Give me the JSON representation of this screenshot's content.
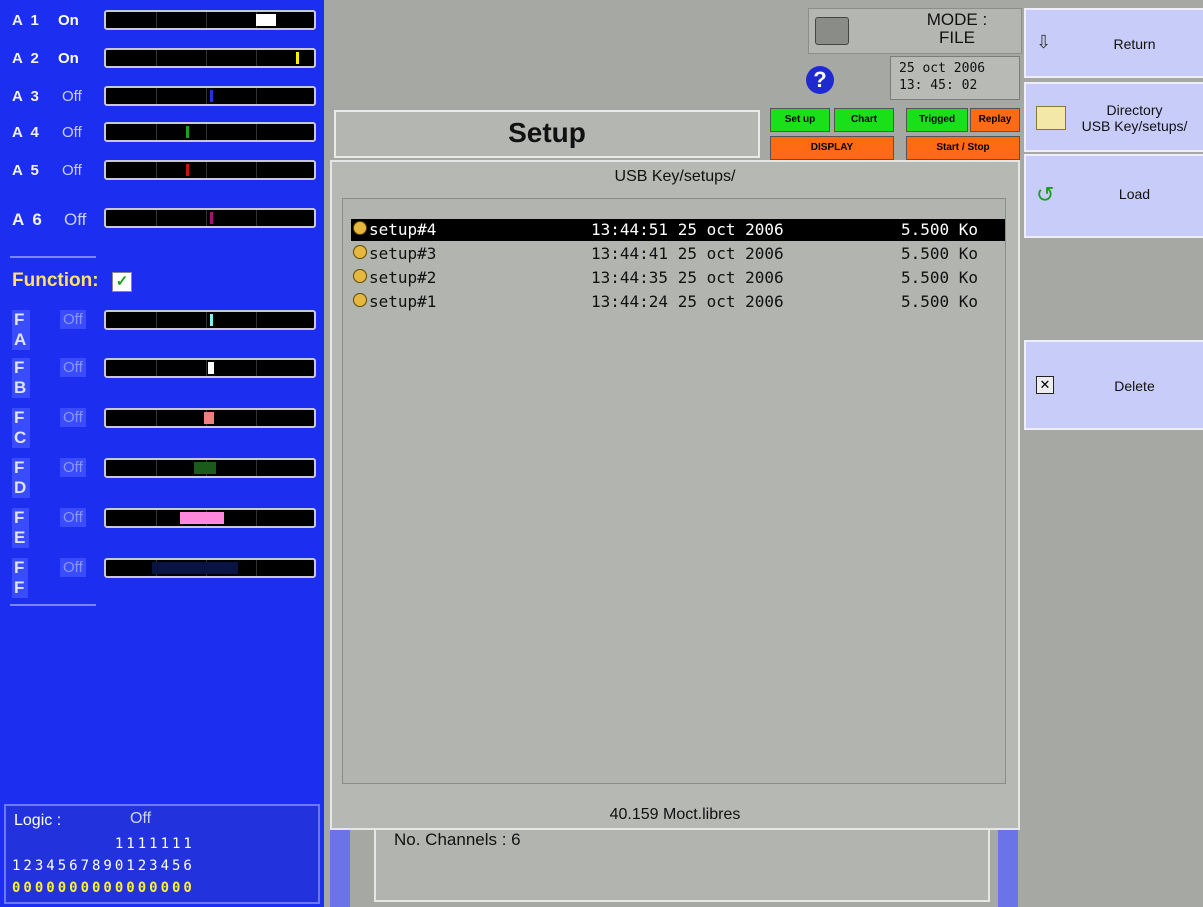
{
  "analog_channels": [
    {
      "name": "A 1",
      "state": "On",
      "mark_color": "#ffffff"
    },
    {
      "name": "A 2",
      "state": "On",
      "mark_color": "#ffee00"
    },
    {
      "name": "A 3",
      "state": "Off",
      "mark_color": "#2233dd"
    },
    {
      "name": "A 4",
      "state": "Off",
      "mark_color": "#1aa01a"
    },
    {
      "name": "A 5",
      "state": "Off",
      "mark_color": "#cc1111"
    },
    {
      "name": "A 6",
      "state": "Off",
      "mark_color": "#aa1177"
    }
  ],
  "function": {
    "label": "Function:",
    "checked": true,
    "check_glyph": "✓"
  },
  "function_channels": [
    {
      "name": "F A",
      "state": "Off",
      "mark_color": "#7ff0f0"
    },
    {
      "name": "F B",
      "state": "Off",
      "mark_color": "#ffffff"
    },
    {
      "name": "F C",
      "state": "Off",
      "mark_color": "#f08080"
    },
    {
      "name": "F D",
      "state": "Off",
      "mark_color": "#1a5a1a"
    },
    {
      "name": "F E",
      "state": "Off",
      "mark_color": "#ff88dd"
    },
    {
      "name": "F F",
      "state": "Off",
      "mark_color": "#0a1444"
    }
  ],
  "logic": {
    "label": "Logic :",
    "state": "Off",
    "tens_row": "         1111111",
    "units_row": "1234567890123456",
    "values_row": "0000000000000000"
  },
  "header": {
    "mode_text": "MODE :\nFILE",
    "date": "25 oct 2006",
    "time": "13: 45: 02",
    "help_glyph": "?"
  },
  "toolbar": {
    "setup": "Set up",
    "chart": "Chart",
    "trigged": "Trigged",
    "replay": "Replay",
    "display": "DISPLAY",
    "start_stop": "Start / Stop"
  },
  "main": {
    "title": "Setup",
    "dialog_title": "USB Key/setups/",
    "files": [
      {
        "name": "setup#4",
        "time": "13:44:51 25 oct 2006",
        "size": "5.500 Ko",
        "selected": true
      },
      {
        "name": "setup#3",
        "time": "13:44:41 25 oct 2006",
        "size": "5.500 Ko",
        "selected": false
      },
      {
        "name": "setup#2",
        "time": "13:44:35 25 oct 2006",
        "size": "5.500 Ko",
        "selected": false
      },
      {
        "name": "setup#1",
        "time": "13:44:24 25 oct 2006",
        "size": "5.500 Ko",
        "selected": false
      }
    ],
    "free_space": "40.159 Moct.libres",
    "channels_text": "No. Channels : 6"
  },
  "menu": {
    "return": "Return",
    "directory": "Directory\nUSB Key/setups/",
    "load": "Load",
    "delete": "Delete"
  }
}
